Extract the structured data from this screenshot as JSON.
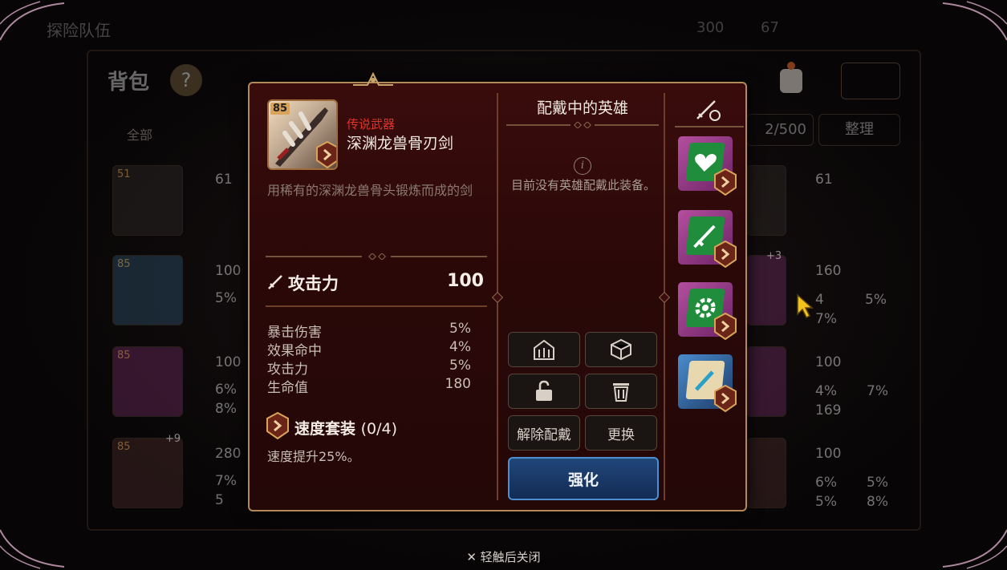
{
  "background": {
    "screen_title": "探险队伍",
    "resources": [
      "300",
      "67"
    ],
    "bag_title": "背包",
    "help_label": "?",
    "filter_all": "全部",
    "capacity": "2/500",
    "sort_label": "整理",
    "left_items": [
      {
        "level": "51",
        "stats": [
          "61"
        ]
      },
      {
        "level": "85",
        "stats": [
          "100",
          "5%"
        ]
      },
      {
        "level": "85",
        "stats": [
          "100",
          "6%",
          "8%"
        ]
      },
      {
        "level": "85",
        "plus": "+9",
        "stats": [
          "280",
          "7%",
          "5"
        ]
      }
    ],
    "right_items": [
      {
        "stats": [
          "61"
        ]
      },
      {
        "plus": "+3",
        "stats": [
          "160",
          "4",
          "5%",
          "7%"
        ]
      },
      {
        "stats": [
          "100",
          "4%",
          "7%",
          "169"
        ]
      },
      {
        "stats": [
          "100",
          "6%",
          "5%",
          "5%",
          "8%"
        ]
      }
    ]
  },
  "item": {
    "level": "85",
    "rarity": "传说武器",
    "name": "深渊龙兽骨刃剑",
    "description": "用稀有的深渊龙兽骨头锻炼而成的剑",
    "main_stat": {
      "label": "攻击力",
      "value": "100"
    },
    "sub_stats": [
      {
        "label": "暴击伤害",
        "value": "5%"
      },
      {
        "label": "效果命中",
        "value": "4%"
      },
      {
        "label": "攻击力",
        "value": "5%"
      },
      {
        "label": "生命值",
        "value": "180"
      }
    ],
    "set": {
      "name": "速度套装",
      "count": "(0/4)",
      "effect": "速度提升25%。"
    }
  },
  "equipped_hero": {
    "title": "配戴中的英雄",
    "empty_message": "目前没有英雄配戴此装备。"
  },
  "actions": {
    "unequip": "解除配戴",
    "replace": "更换",
    "enhance": "强化"
  },
  "gem_slots": [
    "heart-gem",
    "sword-gem",
    "gear-gem",
    "sword-scroll"
  ],
  "close_hint": "轻触后关闭",
  "colors": {
    "rarity": "#e0332a",
    "popup_border": "#b18a58",
    "enhance": "#20467a"
  }
}
